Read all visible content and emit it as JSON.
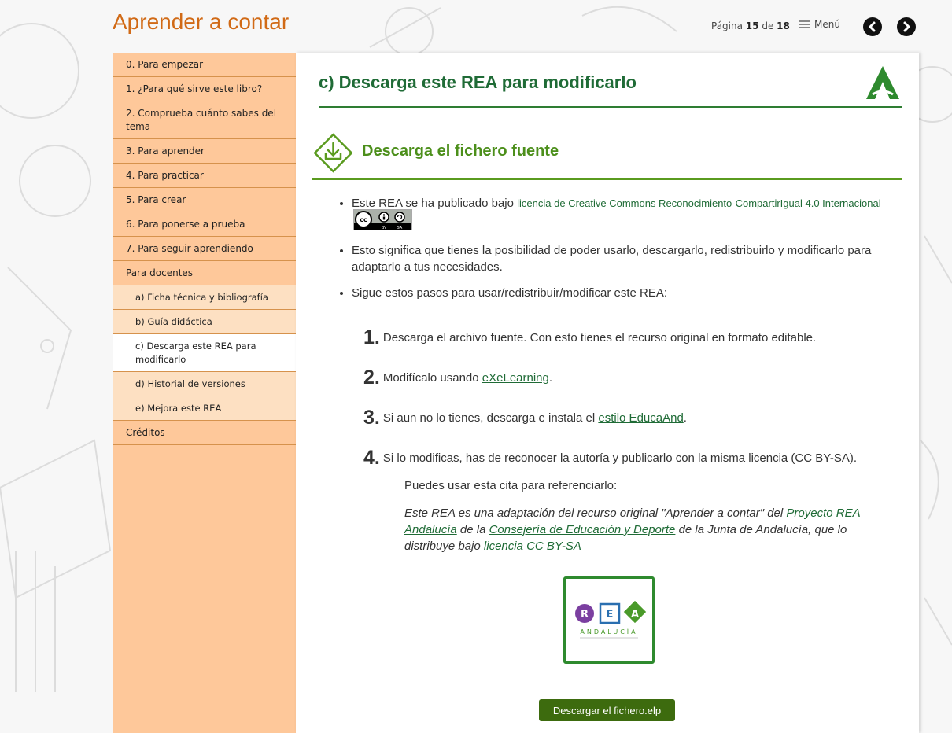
{
  "header": {
    "site_title": "Aprender a contar",
    "page_label": "Página",
    "current_page": "15",
    "of_label": "de",
    "total_pages": "18",
    "menu_label": "Menú"
  },
  "sidebar": {
    "items": [
      {
        "label": "0. Para empezar"
      },
      {
        "label": "1. ¿Para qué sirve este libro?"
      },
      {
        "label": "2. Comprueba cuánto sabes del tema"
      },
      {
        "label": "3. Para aprender"
      },
      {
        "label": "4. Para practicar"
      },
      {
        "label": "5. Para crear"
      },
      {
        "label": "6. Para ponerse a prueba"
      },
      {
        "label": "7. Para seguir aprendiendo"
      },
      {
        "label": "Para docentes"
      },
      {
        "label": "a) Ficha técnica y bibliografía"
      },
      {
        "label": "b) Guía didáctica"
      },
      {
        "label": "c) Descarga este REA para modificarlo"
      },
      {
        "label": "d) Historial de versiones"
      },
      {
        "label": "e) Mejora este REA"
      },
      {
        "label": "Créditos"
      }
    ]
  },
  "main": {
    "page_title": "c) Descarga este REA para modificarlo",
    "section_title": "Descarga el fichero fuente",
    "bullet1_prefix": "Este REA se ha publicado bajo",
    "bullet1_link": "licencia de Creative Commons Reconocimiento-CompartirIgual 4.0 Internacional",
    "bullet2": "Esto significa que tienes la posibilidad de poder usarlo, descargarlo, redistribuirlo y modificarlo para adaptarlo a tus necesidades.",
    "bullet3": "Sigue estos pasos para usar/redistribuir/modificar este REA:",
    "steps": [
      {
        "num": "1.",
        "text": "Descarga el archivo fuente. Con esto tienes el recurso original en formato editable."
      },
      {
        "num": "2.",
        "text_before": "Modifícalo usando",
        "link": "eXeLearning",
        "text_after": "."
      },
      {
        "num": "3.",
        "text_before": "Si aun no lo tienes, descarga e instala el",
        "link": "estilo EducaAnd",
        "text_after": "."
      },
      {
        "num": "4.",
        "text": "Si lo modificas, has de reconocer la autoría y publicarlo con la misma licencia (CC BY-SA)."
      }
    ],
    "cite_intro": "Puedes usar esta cita para referenciarlo:",
    "cite": {
      "p1": "Este REA es una adaptación del recurso original \"Aprender a contar\" del",
      "link1": "Proyecto REA Andalucía",
      "p2": "de la",
      "link2": "Consejería de Educación y Deporte",
      "p3": "de la Junta de Andalucía, que lo distribuye bajo",
      "link3": "licencia CC BY-SA"
    },
    "rea_logo": {
      "r": "R",
      "e": "E",
      "a": "A",
      "andalucia": "ANDALUCÍA"
    },
    "cc_badge": {
      "by": "BY",
      "sa": "SA"
    },
    "download_label": "Descargar el fichero.elp"
  },
  "colors": {
    "title_orange": "#d16a16",
    "sidebar_bg": "#fec89a",
    "green_dark": "#1f6b36",
    "green_light": "#4c8f1b",
    "button_green": "#3d6b0e"
  },
  "icons": [
    "chevron-left-icon",
    "chevron-right-icon",
    "hamburger-icon",
    "download-icon",
    "junta-andalucia-logo",
    "cc-by-sa-badge",
    "rea-andalucia-logo"
  ]
}
